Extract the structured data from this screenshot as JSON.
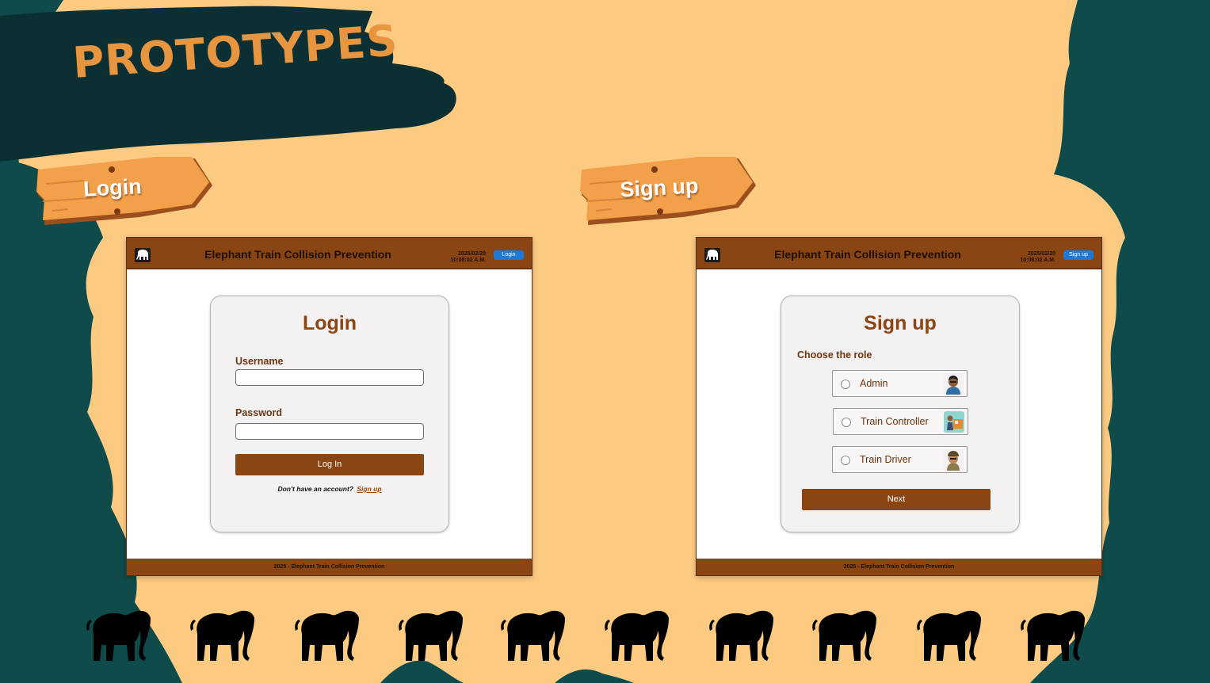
{
  "slide": {
    "title": "PROTOTYPES",
    "sign_login": "Login",
    "sign_signup": "Sign up"
  },
  "login_window": {
    "app_title": "Elephant Train Collision Prevention",
    "date": "2025/02/20",
    "time": "10:08:02 A.M.",
    "header_button": "Login",
    "card_title": "Login",
    "username_label": "Username",
    "password_label": "Password",
    "submit_label": "Log In",
    "hint_text": "Don't have an account?",
    "hint_link": "Sign up",
    "footer": "2025 - Elephant Train Collision Prevention"
  },
  "signup_window": {
    "app_title": "Elephant Train Collision Prevention",
    "date": "2025/02/20",
    "time": "10:08:02 A.M.",
    "header_button": "Sign up",
    "card_title": "Sign up",
    "choose_label": "Choose the role",
    "roles": [
      {
        "label": "Admin",
        "icon": "admin-avatar-icon"
      },
      {
        "label": "Train Controller",
        "icon": "train-controller-avatar-icon"
      },
      {
        "label": "Train Driver",
        "icon": "train-driver-avatar-icon"
      }
    ],
    "next_label": "Next",
    "footer": "2025 - Elephant Train Collision Prevention"
  },
  "colors": {
    "background": "#fdca82",
    "dark_teal": "#0f4b4b",
    "brush_dark": "#0b2f33",
    "brown": "#8b4512",
    "sign_orange": "#f3a04a",
    "accent_blue": "#1d78d6"
  }
}
